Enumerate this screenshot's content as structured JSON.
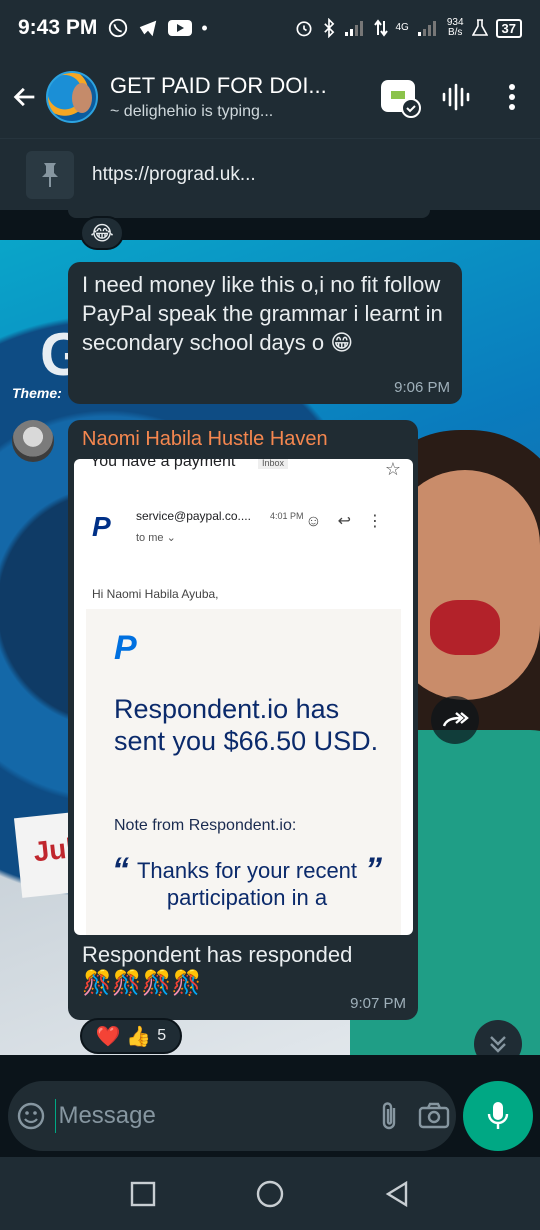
{
  "status_bar": {
    "time": "9:43 PM",
    "network_type": "4G",
    "speed_value": "934",
    "speed_unit": "B/s",
    "battery": "37"
  },
  "header": {
    "title": "GET PAID FOR DOI...",
    "subtitle": "~ delighehio is typing..."
  },
  "pinned": {
    "link": "https://prograd.uk..."
  },
  "messages": {
    "prev_reaction": "😂",
    "msg1": {
      "text": "I need money like this o,i no fit follow PayPal speak the grammar i learnt in secondary school days o 😁",
      "time": "9:06 PM"
    },
    "msg2": {
      "sender": "Naomi Habila Hustle Haven",
      "caption": "Respondent has responded",
      "emojis": "🎊🎊🎊🎊",
      "time": "9:07 PM",
      "reactions": "❤️ 👍",
      "reaction_count": "5",
      "email": {
        "subject": "You have a payment",
        "inbox_label": "Inbox",
        "from": "service@paypal.co....",
        "from_time": "4:01 PM",
        "to": "to me ⌄",
        "greeting": "Hi Naomi Habila Ayuba,",
        "sent_line": "Respondent.io  has sent you $66.50 USD.",
        "note_from": "Note from Respondent.io:",
        "quote": "Thanks for your recent participation in a"
      }
    }
  },
  "wallpaper": {
    "theme_label": "Theme:",
    "tag_text": "Jul"
  },
  "input": {
    "placeholder": "Message"
  },
  "colors": {
    "accent": "#00a884",
    "bubble": "#202c33",
    "header": "#1f2c34",
    "sender_name": "#f5874f"
  }
}
